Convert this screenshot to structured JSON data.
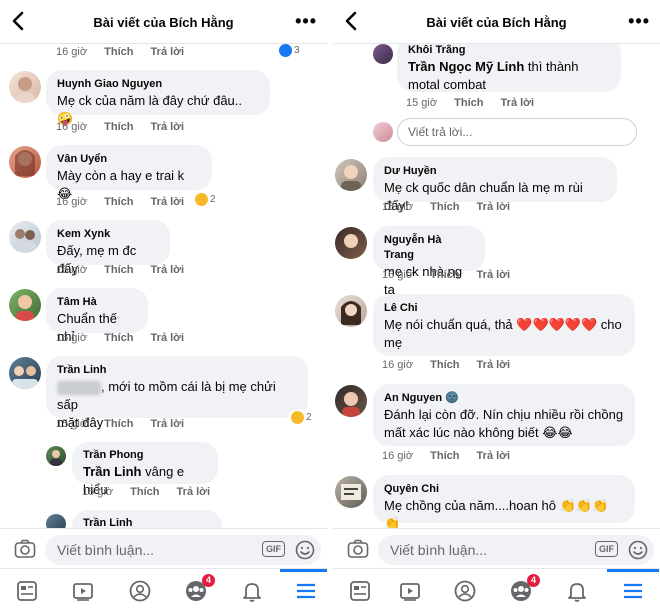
{
  "header": {
    "title": "Bài viết của Bích Hằng"
  },
  "labels": {
    "like": "Thích",
    "reply": "Trả lời"
  },
  "left": {
    "top_meta": {
      "time": "16 giờ",
      "react_count": "3"
    },
    "comments": [
      {
        "name": "Huynh Giao Nguyen",
        "text": "Mẹ ck của năm là đây chứ đâu.. 🤪",
        "time": "16 giờ"
      },
      {
        "name": "Vân Uyển",
        "text": "Mày còn a hay e trai k 😂",
        "time": "16 giờ",
        "react_count": "2"
      },
      {
        "name": "Kem Xynk",
        "text": "Đấy, mẹ m đc đấy",
        "time": "16 giờ"
      },
      {
        "name": "Tâm Hà",
        "text": "Chuẩn thế nhỉ",
        "time": "16 giờ"
      },
      {
        "name": "Trần Linh",
        "text_line1": ", mới to mồm cái là bị mẹ chửi sấp",
        "text_line2": "mặt đây",
        "time": "15 giờ",
        "react_count": "2"
      }
    ],
    "replies": [
      {
        "name": "Trần Phong",
        "mention": "Trần Linh",
        "text": " vâng e hiểu",
        "time": "15 giờ"
      },
      {
        "name": "Trần Linh"
      }
    ]
  },
  "right": {
    "top_reply": {
      "name": "Khôi Trắng",
      "mention": "Trần Ngọc Mỹ Linh",
      "text": " thì thành motal combat",
      "time": "15 giờ"
    },
    "reply_placeholder": "Viết trả lời...",
    "comments": [
      {
        "name": "Dư Huyền",
        "text": "Mẹ ck quốc dân chuẩn là mẹ m rùi đấy!",
        "time": "16 giờ"
      },
      {
        "name": "Nguyễn Hà Trang",
        "text": "mẹ ck nhà ng ta",
        "time": "16 giờ"
      },
      {
        "name": "Lê Chi",
        "text_line1": "Mẹ nói chuẩn quá, thả ❤️❤️❤️❤️❤️ cho",
        "text_line2": "mẹ",
        "time": "16 giờ"
      },
      {
        "name": "An Nguyen",
        "name_suffix": "🌚",
        "text_line1": "Đánh lại còn đỡ. Nín chịu nhiều rồi chồng",
        "text_line2": "mất xác lúc nào không biết 😂😂",
        "time": "16 giờ"
      },
      {
        "name": "Quyên Chi",
        "text": "Mẹ chồng của năm....hoan hô 👏👏👏👏"
      }
    ]
  },
  "composer": {
    "placeholder": "Viết bình luận...",
    "gif": "GIF"
  },
  "navbar": {
    "badge": "4"
  },
  "colors": {
    "accent": "#1877f2",
    "bubble": "#f0f2f5",
    "meta": "#65676b",
    "badge": "#e41e3f"
  }
}
